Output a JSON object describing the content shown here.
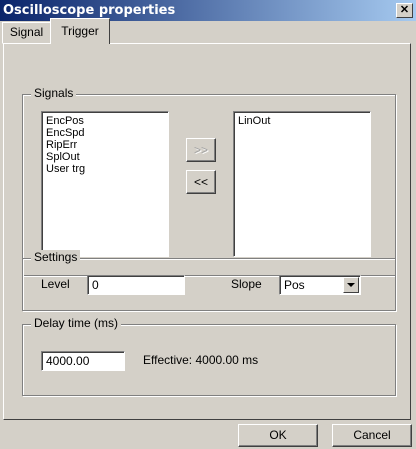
{
  "window": {
    "title": "Oscilloscope properties",
    "close_label": "✕"
  },
  "tabs": [
    {
      "label": "Signal",
      "active": false
    },
    {
      "label": "Trigger",
      "active": true
    }
  ],
  "signals_group": {
    "legend": "Signals",
    "available": [
      "EncPos",
      "EncSpd",
      "RipErr",
      "SplOut",
      "User trg"
    ],
    "selected": [
      "LinOut"
    ],
    "add_label": ">>",
    "remove_label": "<<"
  },
  "settings_group": {
    "legend": "Settings",
    "level_label": "Level",
    "level_value": "0",
    "slope_label": "Slope",
    "slope_value": "Pos"
  },
  "delay_group": {
    "legend": "Delay time (ms)",
    "delay_value": "4000.00",
    "effective_text": "Effective: 4000.00 ms"
  },
  "footer": {
    "ok_label": "OK",
    "cancel_label": "Cancel"
  }
}
